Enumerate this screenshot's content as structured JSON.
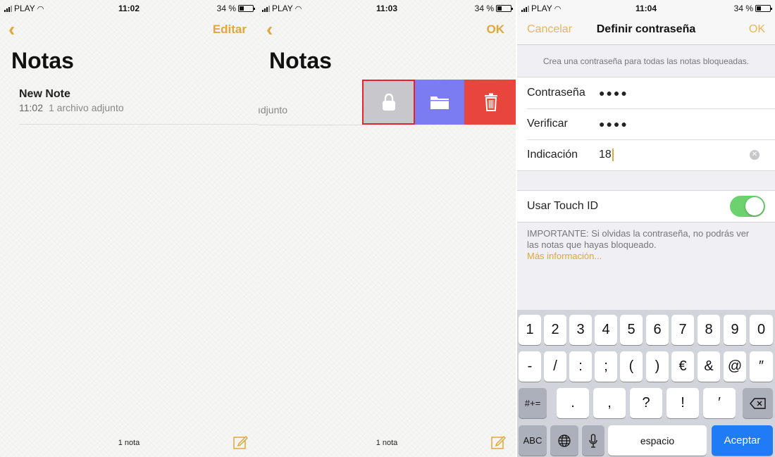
{
  "status": [
    {
      "carrier": "PLAY",
      "time": "11:02",
      "battery": "34 %"
    },
    {
      "carrier": "PLAY",
      "time": "11:03",
      "battery": "34 %"
    },
    {
      "carrier": "PLAY",
      "time": "11:04",
      "battery": "34 %"
    }
  ],
  "screen1": {
    "edit_label": "Editar",
    "title": "Notas",
    "note": {
      "title": "New Note",
      "time": "11:02",
      "subtitle": "1 archivo adjunto"
    },
    "footer_count": "1 nota"
  },
  "screen2": {
    "ok_label": "OK",
    "title": "Notas",
    "swipe_partial_text": "ıdjunto",
    "footer_count": "1 nota",
    "actions": [
      "lock-icon",
      "folder-icon",
      "trash-icon"
    ],
    "colors": {
      "lock": "#c8c8cc",
      "folder": "#7b7cf2",
      "trash": "#e8453c",
      "highlight": "#e1252c"
    }
  },
  "screen3": {
    "cancel_label": "Cancelar",
    "title": "Definir contraseña",
    "ok_label": "OK",
    "hint": "Crea una contraseña para todas las notas bloqueadas.",
    "password_label": "Contraseña",
    "password_value": "●●●●",
    "verify_label": "Verificar",
    "verify_value": "●●●●",
    "hint_label": "Indicación",
    "hint_value": "18",
    "touchid_label": "Usar Touch ID",
    "touchid_on": true,
    "important_text": "IMPORTANTE: Si olvidas la contraseña, no podrás ver las notas que hayas bloqueado.",
    "more_info": "Más información...",
    "keyboard": {
      "row1": [
        "1",
        "2",
        "3",
        "4",
        "5",
        "6",
        "7",
        "8",
        "9",
        "0"
      ],
      "row2": [
        "-",
        "/",
        ":",
        ";",
        "(",
        ")",
        "€",
        "&",
        "@",
        "″"
      ],
      "row3": [
        "#+=",
        ".",
        ",",
        "?",
        "!",
        "′"
      ],
      "abc": "ABC",
      "space": "espacio",
      "enter": "Aceptar"
    }
  },
  "colors": {
    "accent": "#e0a83a",
    "toggle_on": "#6dd26d",
    "enter_key": "#1f7cf6"
  }
}
